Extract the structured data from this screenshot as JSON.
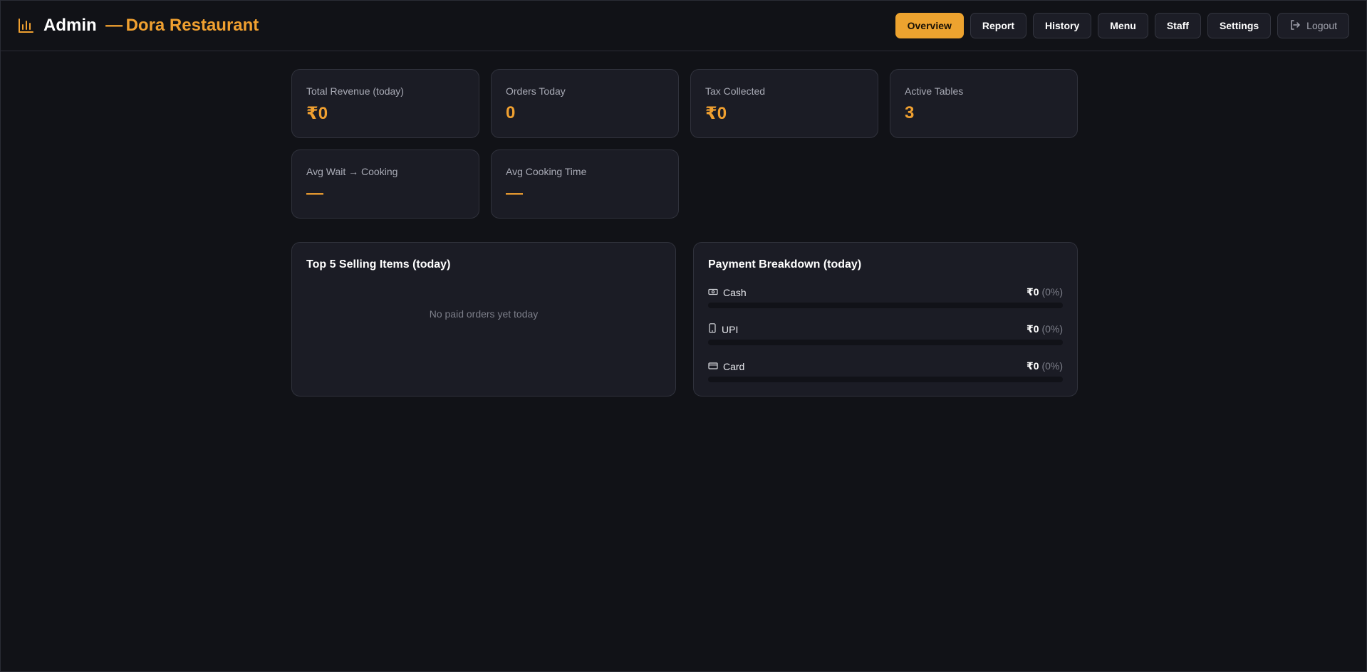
{
  "header": {
    "title": "Admin",
    "separator": "—",
    "restaurant": "Dora Restaurant",
    "nav": [
      {
        "label": "Overview",
        "active": true
      },
      {
        "label": "Report"
      },
      {
        "label": "History"
      },
      {
        "label": "Menu"
      },
      {
        "label": "Staff"
      },
      {
        "label": "Settings"
      }
    ],
    "logout_label": "Logout"
  },
  "stats": [
    {
      "label": "Total Revenue (today)",
      "value": "₹0"
    },
    {
      "label": "Orders Today",
      "value": "0"
    },
    {
      "label": "Tax Collected",
      "value": "₹0"
    },
    {
      "label": "Active Tables",
      "value": "3"
    },
    {
      "label": "Avg Wait → Cooking",
      "value": "—"
    },
    {
      "label": "Avg Cooking Time",
      "value": "—"
    }
  ],
  "top_items": {
    "title": "Top 5 Selling Items (today)",
    "empty_message": "No paid orders yet today"
  },
  "payments": {
    "title": "Payment Breakdown (today)",
    "rows": [
      {
        "name": "Cash",
        "icon": "cash-icon",
        "amount": "₹0",
        "percent": "(0%)",
        "fraction": 0
      },
      {
        "name": "UPI",
        "icon": "phone-icon",
        "amount": "₹0",
        "percent": "(0%)",
        "fraction": 0
      },
      {
        "name": "Card",
        "icon": "card-icon",
        "amount": "₹0",
        "percent": "(0%)",
        "fraction": 0
      }
    ]
  },
  "colors": {
    "accent": "#eda32f",
    "background": "#111217",
    "card": "#1b1c25"
  }
}
